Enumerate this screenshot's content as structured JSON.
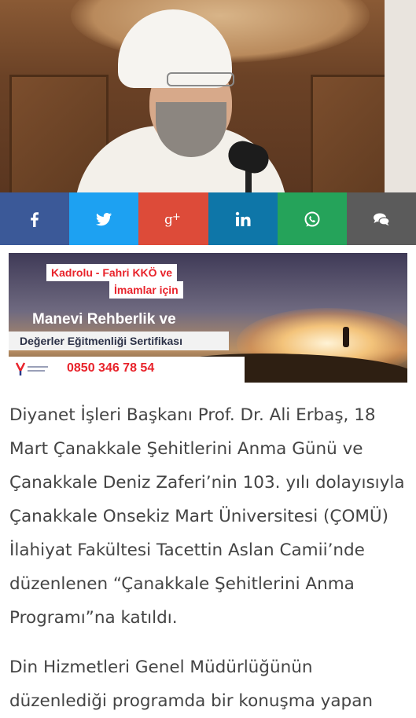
{
  "hero": {
    "alt": "Diyanet İşleri Başkanı Ali Erbaş kürsüde konuşurken"
  },
  "share": [
    {
      "name": "facebook",
      "color": "#3b5998",
      "icon": "facebook-icon"
    },
    {
      "name": "twitter",
      "color": "#1da1f2",
      "icon": "twitter-icon"
    },
    {
      "name": "google-plus",
      "color": "#dd4b39",
      "icon": "google-plus-icon"
    },
    {
      "name": "linkedin",
      "color": "#0e76a8",
      "icon": "linkedin-icon"
    },
    {
      "name": "whatsapp",
      "color": "#25a35a",
      "icon": "whatsapp-icon"
    },
    {
      "name": "comment",
      "color": "#5b5b5b",
      "icon": "comment-icon"
    }
  ],
  "banner": {
    "line1": "Kadrolu - Fahri KKÖ ve",
    "line2": "İmamlar için",
    "title": "Manevi Rehberlik ve",
    "subtitle": "Değerler Eğitmenliği Sertifikası",
    "phone": "0850 346 78 54"
  },
  "article": {
    "paragraph1": "Diyanet İşleri Başkanı Prof. Dr. Ali Erbaş, 18 Mart Çanakkale Şehitlerini Anma Günü ve Çanakkale Deniz Zaferi’nin 103. yılı dolayısıyla Çanakkale Onsekiz Mart Üniversitesi (ÇOMÜ) İlahiyat Fakültesi Tacettin Aslan Camii’nde düzenlenen “Çanakkale Şehitlerini Anma Programı”na katıldı.",
    "paragraph2": "Din Hizmetleri Genel Müdürlüğünün düzenlediği programda bir konuşma yapan"
  }
}
